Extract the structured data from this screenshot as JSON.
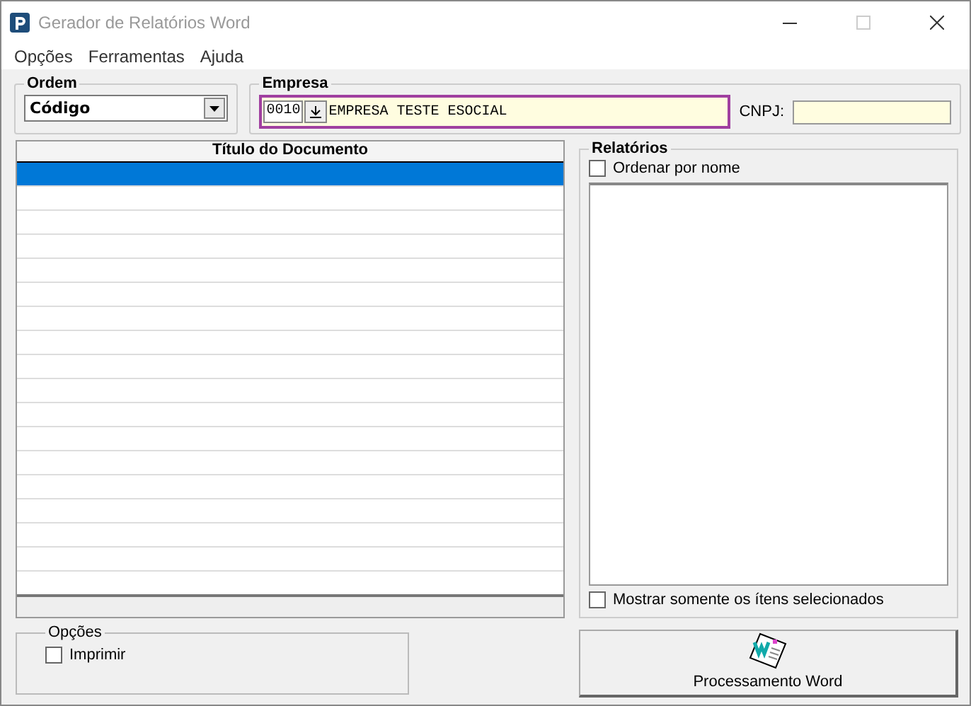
{
  "window": {
    "title": "Gerador de Relatórios Word"
  },
  "menu": [
    "Opções",
    "Ferramentas",
    "Ajuda"
  ],
  "ordem": {
    "label": "Ordem",
    "value": "Código"
  },
  "empresa": {
    "label": "Empresa",
    "code": "0010",
    "name": "EMPRESA TESTE ESOCIAL",
    "cnpj_label": "CNPJ:"
  },
  "table": {
    "columns": [
      "Título do Documento"
    ],
    "rows": [
      {
        "selected": true
      },
      {
        "selected": false
      },
      {
        "selected": false
      },
      {
        "selected": false
      },
      {
        "selected": false
      },
      {
        "selected": false
      },
      {
        "selected": false
      },
      {
        "selected": false
      },
      {
        "selected": false
      },
      {
        "selected": false
      },
      {
        "selected": false
      },
      {
        "selected": false
      },
      {
        "selected": false
      },
      {
        "selected": false
      },
      {
        "selected": false
      },
      {
        "selected": false
      },
      {
        "selected": false
      }
    ]
  },
  "relatorios": {
    "label": "Relatórios",
    "sort_by_name": {
      "label": "Ordenar por nome",
      "checked": false
    },
    "only_selected": {
      "label": "Mostrar somente os ítens selecionados",
      "checked": false
    }
  },
  "opcoes": {
    "label": "Opções",
    "print": {
      "label": "Imprimir",
      "checked": false
    }
  },
  "process_button": "Processamento Word"
}
